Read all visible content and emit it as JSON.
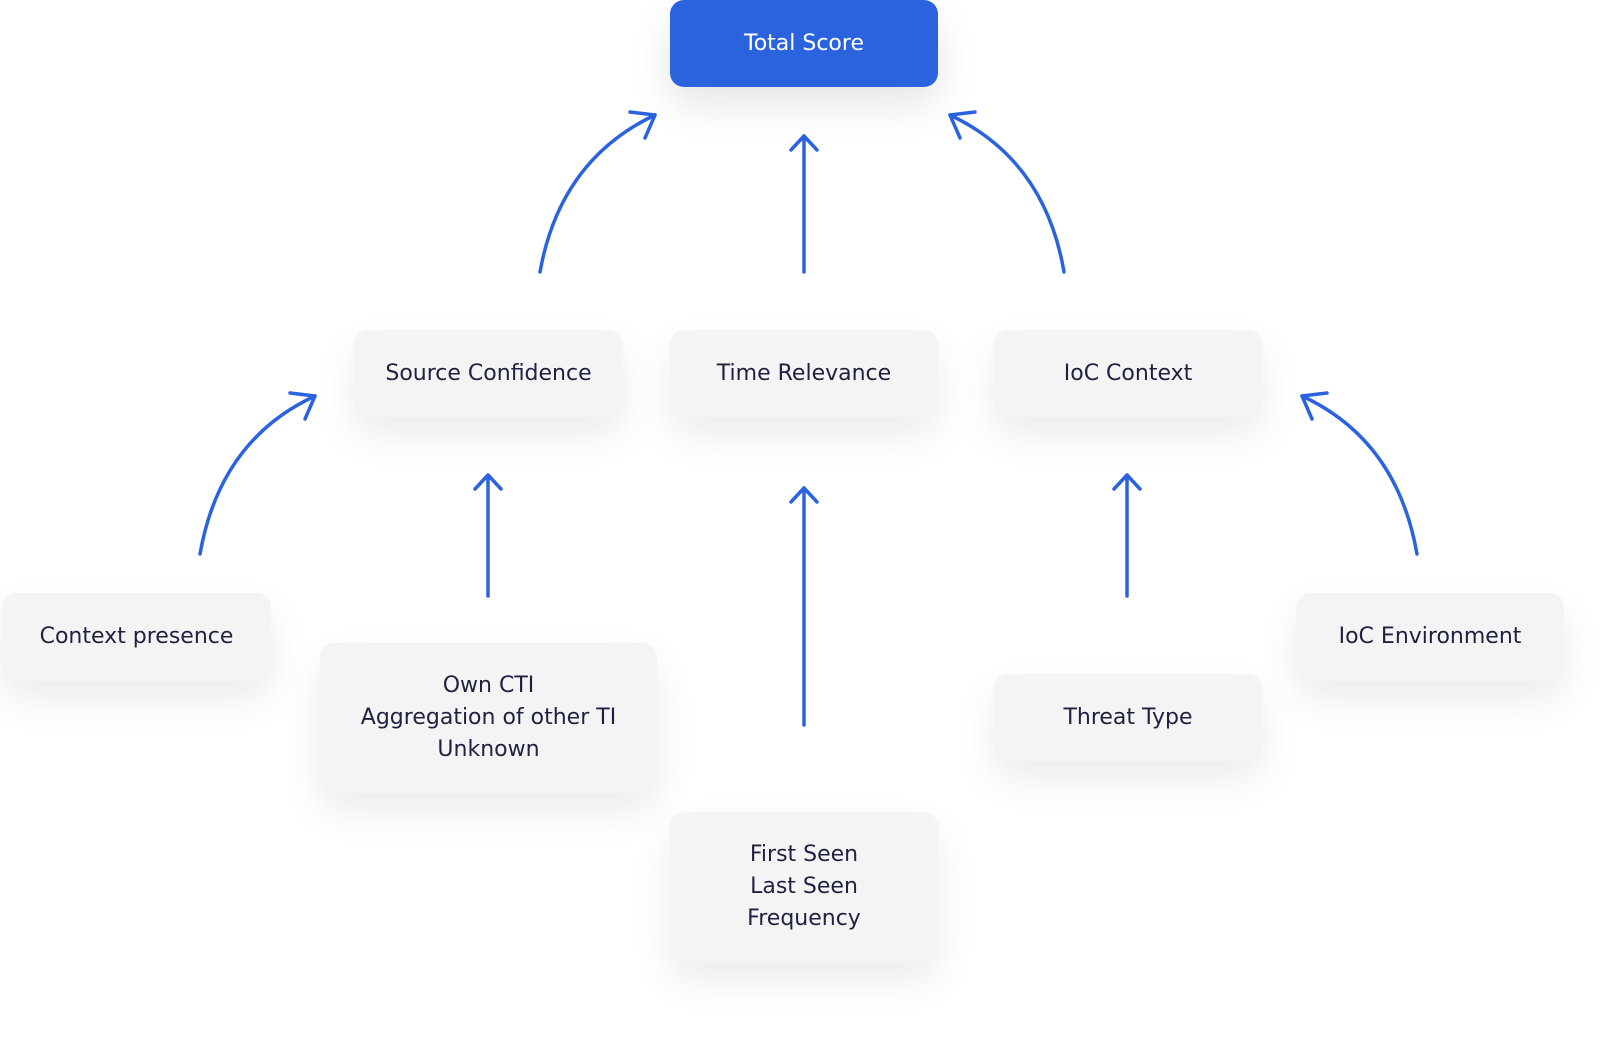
{
  "colors": {
    "accent": "#2b63de",
    "box_bg": "#f5f4f5",
    "text": "#1f2140"
  },
  "nodes": {
    "total_score": "Total Score",
    "source_confidence": "Source Confidence",
    "time_relevance": "Time Relevance",
    "ioc_context": "IoC Context",
    "context_presence": "Context presence",
    "own_cti": "Own CTI\nAggregation of other TI\nUnknown",
    "first_seen": "First Seen\nLast Seen\nFrequency",
    "threat_type": "Threat Type",
    "ioc_environment": "IoC Environment"
  },
  "edges": [
    {
      "from": "source_confidence",
      "to": "total_score"
    },
    {
      "from": "time_relevance",
      "to": "total_score"
    },
    {
      "from": "ioc_context",
      "to": "total_score"
    },
    {
      "from": "context_presence",
      "to": "source_confidence"
    },
    {
      "from": "own_cti",
      "to": "source_confidence"
    },
    {
      "from": "first_seen",
      "to": "time_relevance"
    },
    {
      "from": "threat_type",
      "to": "ioc_context"
    },
    {
      "from": "ioc_environment",
      "to": "ioc_context"
    }
  ]
}
